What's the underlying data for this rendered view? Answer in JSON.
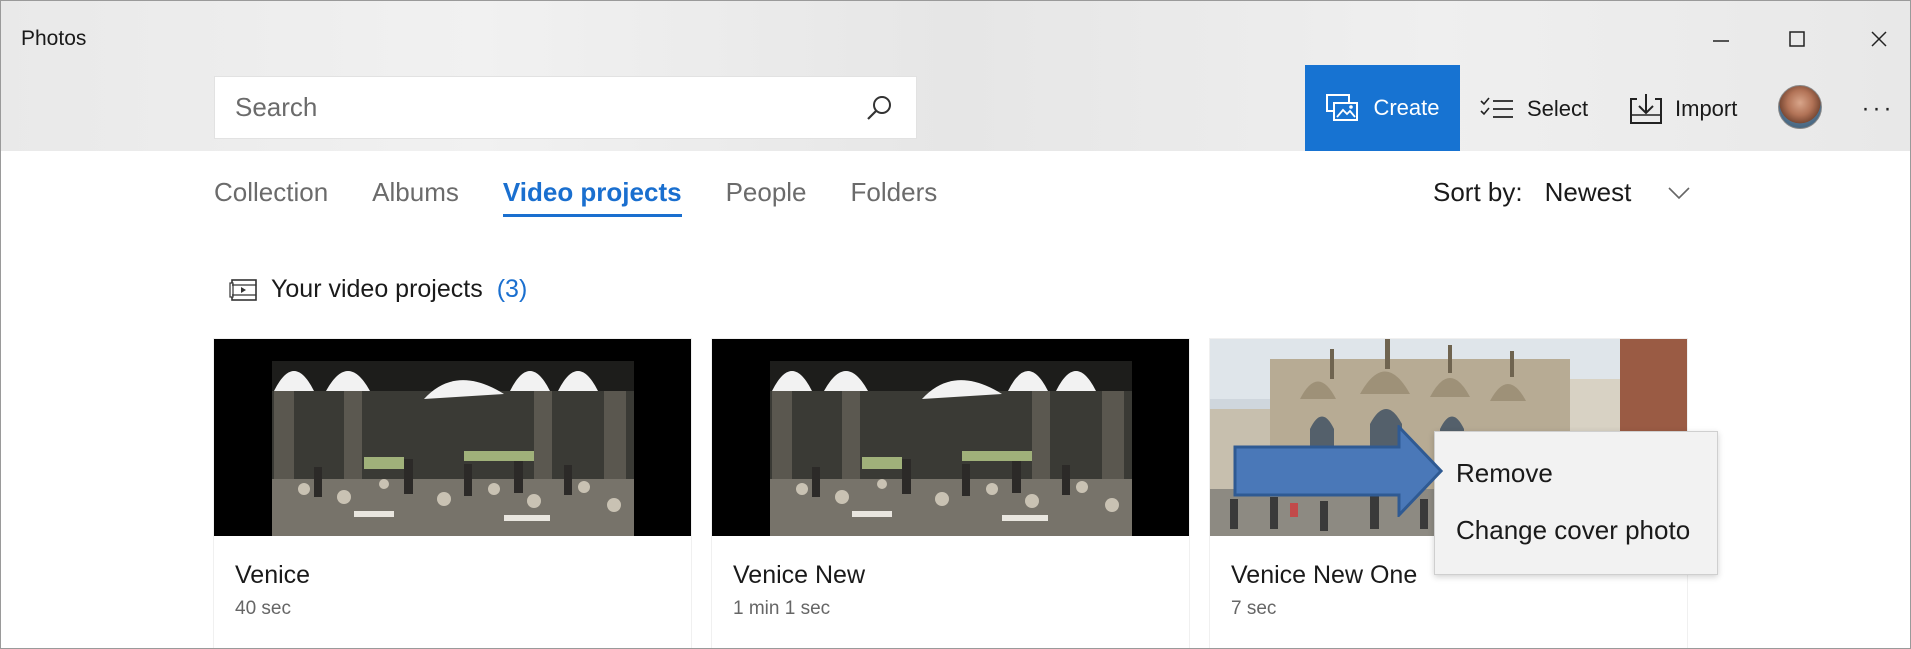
{
  "window": {
    "app_title": "Photos",
    "controls": {
      "minimize_icon": "minimize-icon",
      "maximize_icon": "maximize-icon",
      "close_icon": "close-icon"
    }
  },
  "toolbar": {
    "search": {
      "placeholder": "Search",
      "value": ""
    },
    "create_label": "Create",
    "select_label": "Select",
    "import_label": "Import",
    "more_label": "···",
    "accent_color": "#1773d2"
  },
  "nav": {
    "tabs": [
      {
        "label": "Collection",
        "active": false
      },
      {
        "label": "Albums",
        "active": false
      },
      {
        "label": "Video projects",
        "active": true
      },
      {
        "label": "People",
        "active": false
      },
      {
        "label": "Folders",
        "active": false
      }
    ],
    "sort_label": "Sort by:",
    "sort_value": "Newest"
  },
  "section": {
    "title": "Your video projects",
    "count": "(3)"
  },
  "projects": [
    {
      "title": "Venice",
      "duration": "40 sec"
    },
    {
      "title": "Venice New",
      "duration": "1 min 1 sec"
    },
    {
      "title": "Venice New One",
      "duration": "7 sec"
    }
  ],
  "context_menu": {
    "items": [
      "Remove",
      "Change cover photo"
    ]
  }
}
